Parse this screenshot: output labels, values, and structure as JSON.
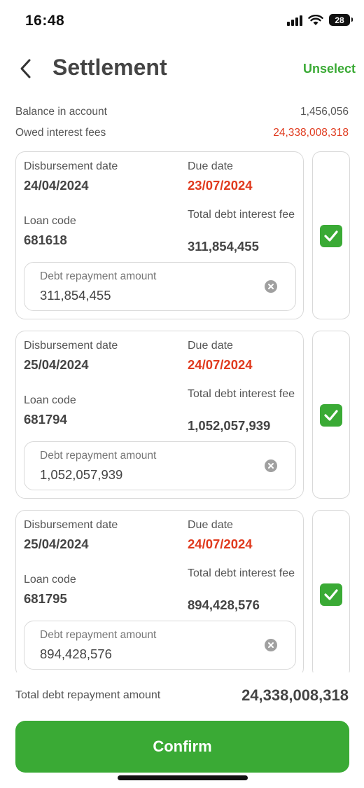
{
  "status_bar": {
    "time": "16:48",
    "battery": "28"
  },
  "header": {
    "title": "Settlement",
    "unselect_label": "Unselect"
  },
  "summary": {
    "balance_label": "Balance in account",
    "balance_value": "1,456,056",
    "owed_label": "Owed interest fees",
    "owed_value": "24,338,008,318"
  },
  "loans": [
    {
      "disbursement_label": "Disbursement date",
      "disbursement_date": "24/04/2024",
      "due_label": "Due date",
      "due_date": "23/07/2024",
      "loan_code_label": "Loan code",
      "loan_code": "681618",
      "total_fee_label": "Total debt interest fee",
      "total_fee": "311,854,455",
      "repay_label": "Debt repayment amount",
      "repay_value": "311,854,455",
      "selected": true
    },
    {
      "disbursement_label": "Disbursement date",
      "disbursement_date": "25/04/2024",
      "due_label": "Due date",
      "due_date": "24/07/2024",
      "loan_code_label": "Loan code",
      "loan_code": "681794",
      "total_fee_label": "Total debt interest fee",
      "total_fee": "1,052,057,939",
      "repay_label": "Debt repayment amount",
      "repay_value": "1,052,057,939",
      "selected": true
    },
    {
      "disbursement_label": "Disbursement date",
      "disbursement_date": "25/04/2024",
      "due_label": "Due date",
      "due_date": "24/07/2024",
      "loan_code_label": "Loan code",
      "loan_code": "681795",
      "total_fee_label": "Total debt interest fee",
      "total_fee": "894,428,576",
      "repay_label": "Debt repayment amount",
      "repay_value": "894,428,576",
      "selected": true
    }
  ],
  "footer": {
    "total_label": "Total debt repayment amount",
    "total_value": "24,338,008,318",
    "confirm_label": "Confirm"
  },
  "colors": {
    "accent": "#3aaa35",
    "due_red": "#e03a1e"
  },
  "icons": {
    "back": "chevron-left-icon",
    "clear": "clear-circle-icon",
    "check": "checkbox-checked-icon",
    "wifi": "wifi-icon",
    "signal": "signal-icon",
    "battery": "battery-icon"
  }
}
